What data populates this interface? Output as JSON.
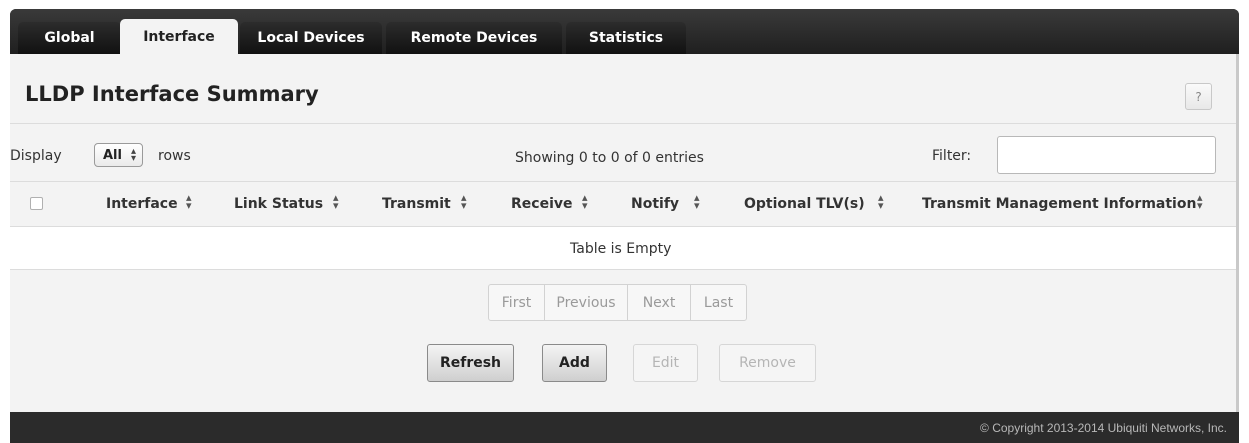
{
  "tabs": [
    {
      "label": "Global",
      "active": false
    },
    {
      "label": "Interface",
      "active": true
    },
    {
      "label": "Local Devices",
      "active": false
    },
    {
      "label": "Remote Devices",
      "active": false
    },
    {
      "label": "Statistics",
      "active": false
    }
  ],
  "page": {
    "title": "LLDP Interface Summary",
    "help_label": "?"
  },
  "controls": {
    "display_label": "Display",
    "rows_value": "All",
    "rows_label": "rows",
    "showing_text": "Showing 0 to 0 of 0 entries",
    "filter_label": "Filter:",
    "filter_value": ""
  },
  "table": {
    "columns": [
      "Interface",
      "Link Status",
      "Transmit",
      "Receive",
      "Notify",
      "Optional TLV(s)",
      "Transmit Management Information"
    ],
    "empty_text": "Table is Empty"
  },
  "pagination": {
    "first": "First",
    "previous": "Previous",
    "next": "Next",
    "last": "Last"
  },
  "buttons": {
    "refresh": "Refresh",
    "add": "Add",
    "edit": "Edit",
    "remove": "Remove"
  },
  "footer": {
    "copyright": "© Copyright 2013-2014 Ubiquiti Networks, Inc."
  },
  "colors": {
    "tabbar": "#2b2b2b",
    "panel": "#f3f3f3",
    "disabled_text": "#b5b5b5"
  },
  "icons": {
    "sort": "sort-arrows-icon",
    "help": "help-icon",
    "select_caret": "select-caret-icon"
  }
}
